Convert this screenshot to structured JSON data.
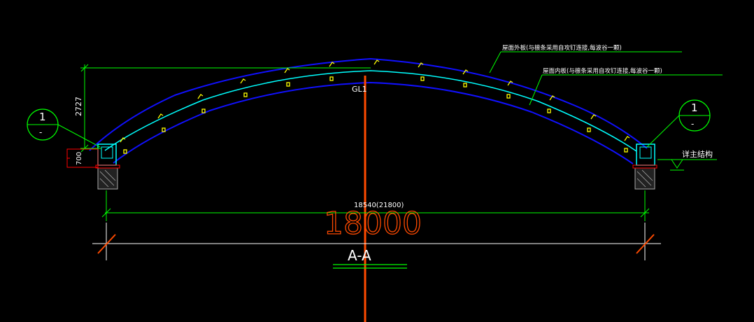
{
  "drawing": {
    "roof_outer_label": "屋面外板(与檩条采用自攻钉连接,每波谷一颗)",
    "roof_inner_label": "屋面内板(与檩条采用自攻钉连接,每波谷一颗)",
    "girder_label": "GL1",
    "height_dim": "2727",
    "support_dim": "700",
    "span_text": "18540(21800)",
    "span_big": "18000",
    "section_title": "A-A",
    "detail_left": {
      "number": "1",
      "sub": "-"
    },
    "detail_right": {
      "number": "1",
      "sub": "-"
    },
    "main_structure_label": "详主结构"
  },
  "colors": {
    "background": "#000000",
    "outer_arc": "#0000ff",
    "inner_arc": "#00ffff",
    "dimension": "#00ff00",
    "axis": "#ff4a00",
    "purlin": "#ffff00",
    "text": "#ffffff"
  }
}
